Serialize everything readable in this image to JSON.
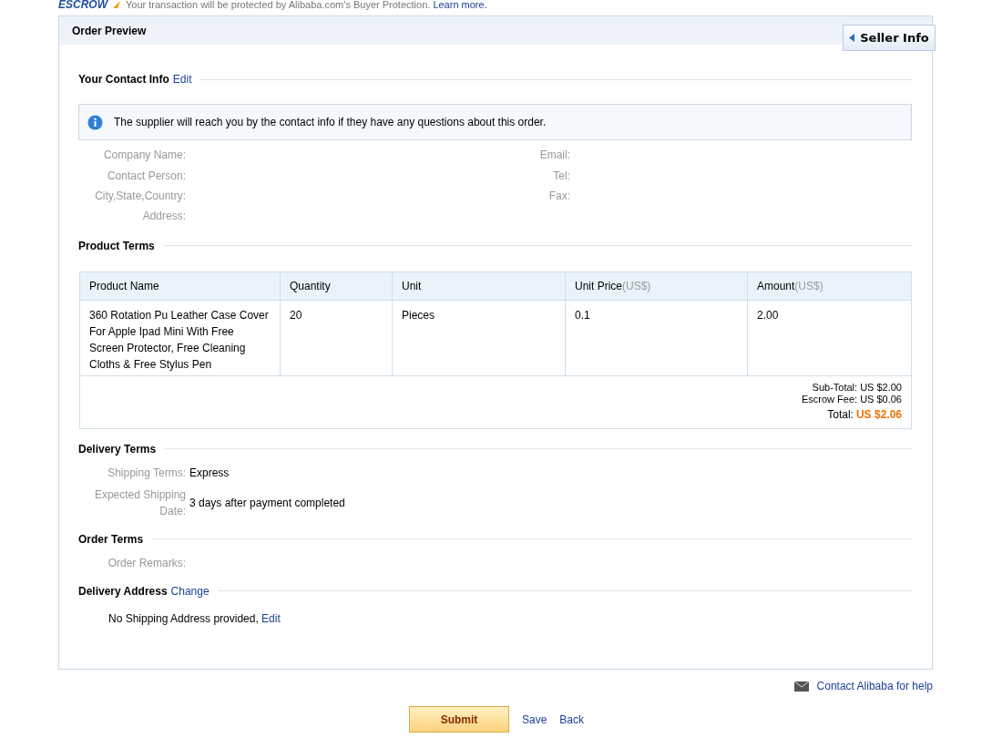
{
  "top_bar": {
    "logo": "ESCROW",
    "message": "Your transaction will be protected by Alibaba.com's Buyer Protection.",
    "link": "Learn more."
  },
  "panel": {
    "title": "Order Preview",
    "seller_tab": "Seller Info"
  },
  "contact": {
    "heading": "Your Contact Info",
    "edit_link": "Edit",
    "notice": "The supplier will reach you by the contact info if they have any questions about this order.",
    "left_fields": [
      {
        "label": "Company Name:"
      },
      {
        "label": "Contact Person:"
      },
      {
        "label": "City,State,Country:"
      },
      {
        "label": "Address:"
      }
    ],
    "right_fields": [
      {
        "label": "Email:"
      },
      {
        "label": "Tel:"
      },
      {
        "label": "Fax:"
      }
    ]
  },
  "product_terms": {
    "heading": "Product Terms",
    "columns": [
      {
        "label": "Product Name"
      },
      {
        "label": "Quantity"
      },
      {
        "label": "Unit"
      },
      {
        "label": "Unit Price",
        "unit": "(US$)"
      },
      {
        "label": "Amount",
        "unit": "(US$)"
      }
    ],
    "rows": [
      [
        "360 Rotation Pu Leather Case Cover For Apple Ipad Mini With Free Screen Protector, Free Cleaning Cloths & Free Stylus Pen",
        "20",
        "Pieces",
        "0.1",
        "2.00"
      ]
    ],
    "totals": [
      {
        "kind": "plain",
        "label": "Sub-Total:",
        "value": "US $2.00"
      },
      {
        "kind": "plain",
        "label": "Escrow Fee:",
        "value": "US $0.06"
      },
      {
        "kind": "grand",
        "label": "Total:",
        "value": "US $2.06"
      }
    ]
  },
  "delivery_terms": {
    "heading": "Delivery Terms",
    "fields": [
      {
        "label": "Shipping Terms:",
        "value": "Express"
      },
      {
        "label": "Expected Shipping Date:",
        "value": "3 days after payment completed"
      }
    ]
  },
  "order_terms": {
    "heading": "Order Terms",
    "fields": [
      {
        "label": "Order Remarks:"
      }
    ]
  },
  "delivery_address": {
    "heading": "Delivery Address",
    "change_link": "Change",
    "message": "No Shipping Address provided,",
    "edit_link": "Edit"
  },
  "help_link": "Contact Alibaba for help",
  "actions": {
    "submit": "Submit",
    "links": [
      "Save",
      "Back"
    ]
  }
}
